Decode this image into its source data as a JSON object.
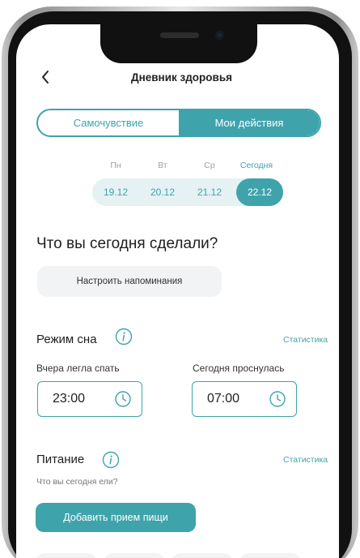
{
  "header": {
    "title": "Дневник здоровья",
    "back_icon": "chevron-left-icon"
  },
  "tabs": [
    {
      "label": "Самочувствие",
      "active": false
    },
    {
      "label": "Мои действия",
      "active": true
    }
  ],
  "days": [
    {
      "name": "Пн",
      "date": "19.12",
      "active": false
    },
    {
      "name": "Вт",
      "date": "20.12",
      "active": false
    },
    {
      "name": "Ср",
      "date": "21.12",
      "active": false
    },
    {
      "name": "Сегодня",
      "date": "22.12",
      "active": true
    }
  ],
  "main": {
    "question": "Что вы сегодня сделали?",
    "reminder_button": "Настроить напоминания"
  },
  "sleep": {
    "title": "Режим сна",
    "stats": "Статистика",
    "bed_label": "Вчера легла спать",
    "bed_time": "23:00",
    "wake_label": "Сегодня проснулась",
    "wake_time": "07:00"
  },
  "nutrition": {
    "title": "Питание",
    "stats": "Статистика",
    "subtitle": "Что вы сегодня ели?",
    "add_button": "Добавить прием пищи"
  },
  "colors": {
    "accent": "#3fa3ac",
    "strip": "#e6f1f3",
    "button_grey": "#f1f3f4"
  }
}
